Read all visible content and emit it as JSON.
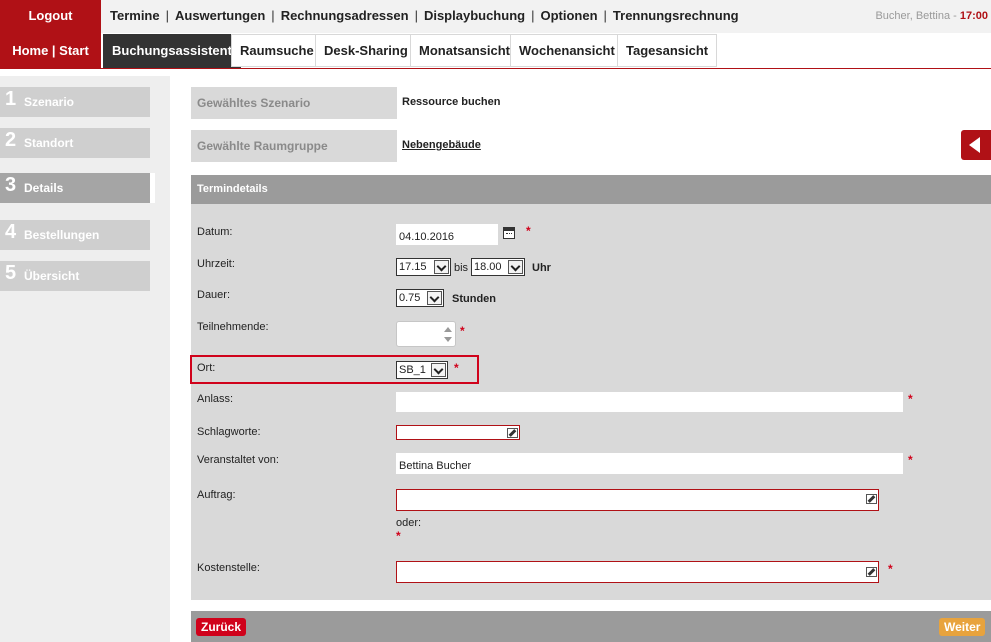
{
  "topbar": {
    "logout": "Logout",
    "menu": [
      "Termine",
      "Auswertungen",
      "Rechnungsadressen",
      "Displaybuchung",
      "Optionen",
      "Trennungsrechnung"
    ],
    "user": "Bucher, Bettina",
    "time": "17:00",
    "sep": "|",
    "user_sep": " - "
  },
  "tabs": {
    "home": "Home | Start",
    "items": [
      "Buchungsassistent",
      "Raumsuche",
      "Desk-Sharing",
      "Monatsansicht",
      "Wochenansicht",
      "Tagesansicht"
    ]
  },
  "sidebar": {
    "steps": [
      {
        "num": "1",
        "label": "Szenario"
      },
      {
        "num": "2",
        "label": "Standort"
      },
      {
        "num": "3",
        "label": "Details"
      },
      {
        "num": "4",
        "label": "Bestellungen"
      },
      {
        "num": "5",
        "label": "Übersicht"
      }
    ]
  },
  "summary": {
    "scenario_label": "Gewähltes Szenario",
    "scenario_value": "Ressource buchen",
    "roomgroup_label": "Gewählte Raumgruppe",
    "roomgroup_value": "Nebengebäude"
  },
  "details": {
    "title": "Termindetails",
    "required_mark": "*",
    "datum_label": "Datum:",
    "datum_value": "04.10.2016",
    "uhrzeit_label": "Uhrzeit:",
    "uhrzeit_from": "17.15",
    "uhrzeit_bis": "bis",
    "uhrzeit_to": "18.00",
    "uhrzeit_unit": "Uhr",
    "dauer_label": "Dauer:",
    "dauer_value": "0.75",
    "dauer_unit": "Stunden",
    "teilnehmende_label": "Teilnehmende:",
    "teilnehmende_value": "",
    "ort_label": "Ort:",
    "ort_value": "SB_1",
    "anlass_label": "Anlass:",
    "anlass_value": "",
    "schlagworte_label": "Schlagworte:",
    "veranstaltet_label": "Veranstaltet von:",
    "veranstaltet_value": "Bettina Bucher",
    "auftrag_label": "Auftrag:",
    "oder": "oder:",
    "kostenstelle_label": "Kostenstelle:"
  },
  "footer": {
    "back": "Zurück",
    "next": "Weiter"
  },
  "colors": {
    "brand_red": "#b01116",
    "next_orange": "#e8a33d"
  }
}
